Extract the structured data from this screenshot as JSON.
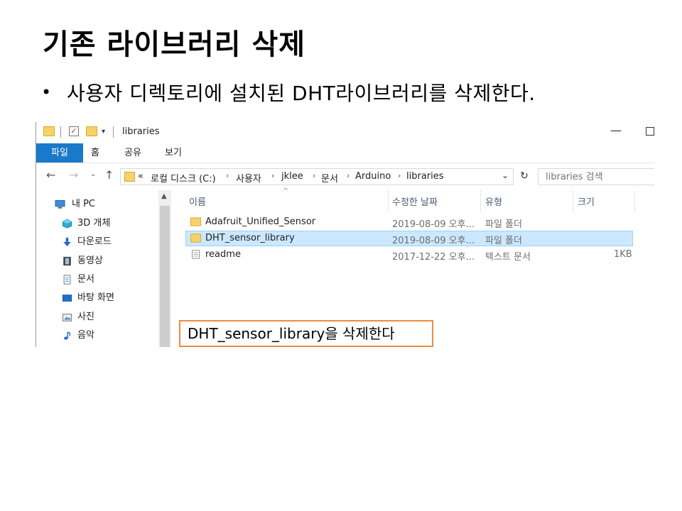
{
  "slide": {
    "title": "기존 라이브러리 삭제",
    "bullet": "사용자 디렉토리에 설치된 DHT라이브러리를 삭제한다."
  },
  "explorer": {
    "window_title": "libraries",
    "ribbon_tabs": [
      "파일",
      "홈",
      "공유",
      "보기"
    ],
    "breadcrumb_overflow": "«",
    "breadcrumb": [
      "로컬 디스크 (C:)",
      "사용자",
      "jklee",
      "문서",
      "Arduino",
      "libraries"
    ],
    "search_placeholder": "libraries 검색",
    "sidebar_items": [
      {
        "label": "내 PC",
        "icon": "pc-icon"
      },
      {
        "label": "3D 개체",
        "icon": "3d-objects-icon"
      },
      {
        "label": "다운로드",
        "icon": "download-icon"
      },
      {
        "label": "동영상",
        "icon": "video-icon"
      },
      {
        "label": "문서",
        "icon": "document-icon"
      },
      {
        "label": "바탕 화면",
        "icon": "desktop-icon"
      },
      {
        "label": "사진",
        "icon": "picture-icon"
      },
      {
        "label": "음악",
        "icon": "music-icon"
      }
    ],
    "columns": {
      "name": "이름",
      "modified": "수정한 날짜",
      "type": "유형",
      "size": "크기"
    },
    "files": [
      {
        "name": "Adafruit_Unified_Sensor",
        "modified": "2019-08-09 오후...",
        "type": "파일 폴더",
        "size": "",
        "icon": "folder-icon",
        "selected": false
      },
      {
        "name": "DHT_sensor_library",
        "modified": "2019-08-09 오후...",
        "type": "파일 폴더",
        "size": "",
        "icon": "folder-icon",
        "selected": true
      },
      {
        "name": "readme",
        "modified": "2017-12-22 오후...",
        "type": "텍스트 문서",
        "size": "1KB",
        "icon": "text-file-icon",
        "selected": false
      }
    ]
  },
  "callout": {
    "text": "DHT_sensor_library을  삭제한다"
  },
  "colors": {
    "file_tab": "#1979ca",
    "selection_bg": "#cce8ff",
    "callout_border": "#f08b3c",
    "folder": "#f6d36a"
  }
}
